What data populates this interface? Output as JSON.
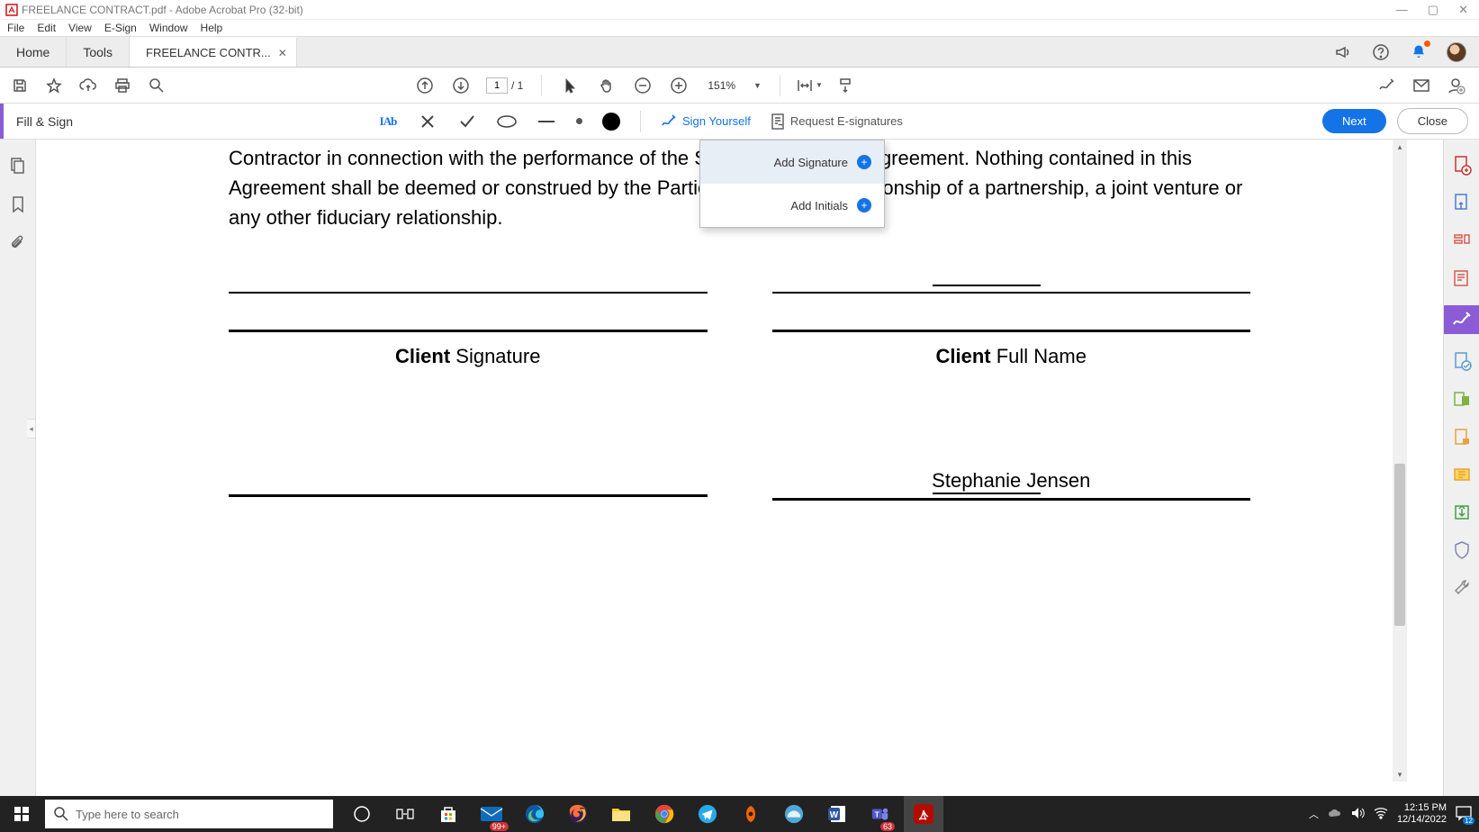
{
  "window": {
    "title": "FREELANCE CONTRACT.pdf - Adobe Acrobat Pro (32-bit)"
  },
  "menu": {
    "file": "File",
    "edit": "Edit",
    "view": "View",
    "esign": "E-Sign",
    "window": "Window",
    "help": "Help"
  },
  "tabs": {
    "home": "Home",
    "tools": "Tools",
    "doc": "FREELANCE CONTR..."
  },
  "toolbar": {
    "page_current": "1",
    "page_total": "/ 1",
    "zoom": "151%"
  },
  "fillsign": {
    "title": "Fill & Sign",
    "iab": "IAb",
    "sign_yourself": "Sign Yourself",
    "request": "Request E-signatures",
    "next": "Next",
    "close": "Close"
  },
  "popup": {
    "add_signature": "Add Signature",
    "add_initials": "Add Initials"
  },
  "document": {
    "paragraph": "Contractor in connection with the performance of the Services under this Agreement. Nothing contained in this Agreement shall be deemed or construed by the Parties to create the relationship of a partnership, a joint venture or any other fiduciary relationship.",
    "client_sig_bold": "Client",
    "client_sig_rest": " Signature",
    "client_name_bold": "Client",
    "client_name_rest": " Full Name",
    "freelancer_name": "Stephanie Jensen"
  },
  "taskbar": {
    "search_placeholder": "Type here to search",
    "time": "12:15 PM",
    "date": "12/14/2022",
    "badge": "99+",
    "teams_badge": "63",
    "notif_count": "12"
  }
}
